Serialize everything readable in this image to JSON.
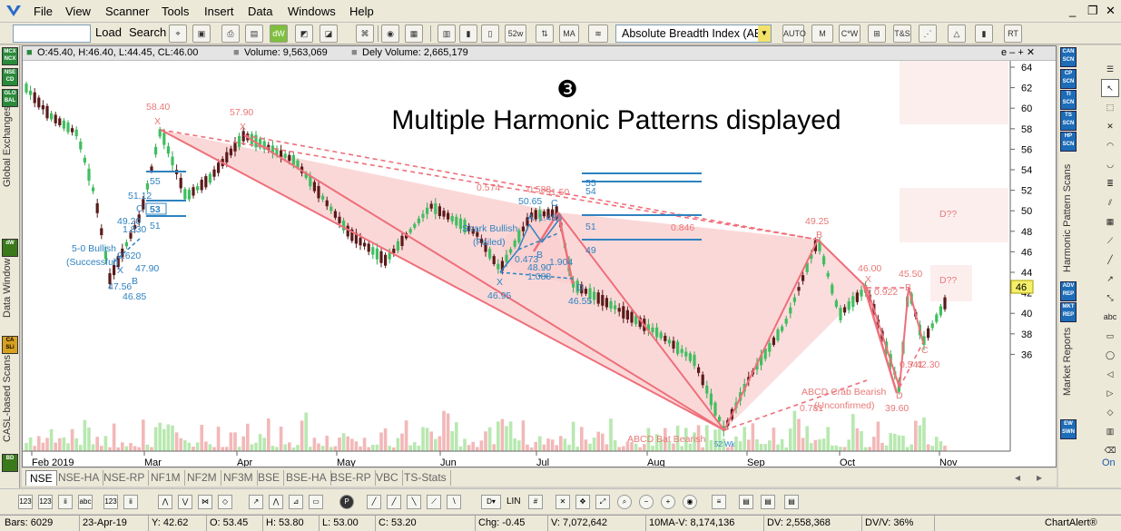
{
  "menu": {
    "items": [
      "File",
      "View",
      "Scanner",
      "Tools",
      "Insert",
      "Data",
      "Windows",
      "Help"
    ],
    "window_controls": [
      "_",
      "❐",
      "✕"
    ]
  },
  "toolbar": {
    "load": "Load",
    "search": "Search",
    "indicator": "Absolute Breadth Index (ABI",
    "btn_52w": "52w HiLo",
    "btn_ma": "MA",
    "btn_fibo": "AUTO FIBO",
    "btn_pvt": "M PVT",
    "btn_cw": "C*W TAM",
    "btn_ts": "T&S",
    "btn_rt": "RT"
  },
  "left_panel": {
    "btn1": "MCX NCX",
    "btn2": "NSE CD",
    "btn3": "GLO BAL",
    "label1": "Global Exchanges",
    "btn4": "dW",
    "label2": "Data Window",
    "btn5": "CA SLi",
    "label3": "CASL-based Scans",
    "btn6": "BD"
  },
  "infobar": {
    "ohlc": "O:45.40, H:46.40, L:44.45, CL:46.00",
    "volume": "Volume: 9,563,069",
    "dely": "Dely Volume: 2,665,179",
    "controls": "e – + ✕"
  },
  "chart": {
    "annotation_number": "❸",
    "annotation_text": "Multiple Harmonic Patterns displayed",
    "price_ticks": [
      "64",
      "62",
      "60",
      "58",
      "56",
      "54",
      "52",
      "50",
      "48",
      "46",
      "44",
      "42",
      "40",
      "38",
      "36"
    ],
    "current_price": "46",
    "months": [
      "Feb 2019",
      "Mar",
      "Apr",
      "May",
      "Jun",
      "Jul",
      "Aug",
      "Sep",
      "Oct",
      "Nov"
    ],
    "labels": {
      "x_price": "58.40",
      "x_mark": "X",
      "x2_price": "57.90",
      "x2_mark": "X",
      "v574": "0.574",
      "v588": "0.588",
      "v150": "51.50",
      "shark": "Shark Bullish",
      "shark_status": "(Failed)",
      "s5065": "50.65",
      "s1486": "1.486",
      "s0473": "0.473",
      "s1904": "1.904",
      "s4890": "48.90",
      "s1088": "1.088",
      "sa": "A",
      "sb": "B",
      "sc": "C",
      "sx": "X",
      "sd": "D",
      "s4695": "46.95",
      "s4655": "46.55",
      "r55": "55",
      "r54": "54",
      "r51": "51",
      "r49": "49",
      "r0846": "0.846",
      "b4925": "49.25",
      "bb": "B",
      "b4600": "46.00",
      "bx": "X",
      "b0922": "0.922",
      "b4550": "45.50",
      "b2": "B",
      "dq1": "D??",
      "dq2": "D??",
      "c0541": "0.541",
      "c4230": "42.30",
      "cc": "C",
      "cd": "D",
      "c3960": "39.60",
      "crab": "ABCD Crab Bearish",
      "crab_status": "(Unconfirmed)",
      "c0781": "0.781",
      "bat": "ABCD Bat Bearish",
      "w52": "52 Wk",
      "p50": "5-0 Bullish",
      "p50s": "(Successful)",
      "p5112": "51.12",
      "p4920": "49.20",
      "p1830": "1.830",
      "p0620": "0.620",
      "p4790": "47.90",
      "p4756": "47.56",
      "p4685": "46.85",
      "pc": "C",
      "pb": "B",
      "px": "X",
      "r55b": "55",
      "r53": "53",
      "r51b": "51",
      "r53v": "53"
    }
  },
  "tabs": [
    "NSE",
    "NSE-HA",
    "NSE-RP",
    "NF1M",
    "NF2M",
    "NF3M",
    "BSE",
    "BSE-HA",
    "BSE-RP",
    "VBC",
    "TS-Stats"
  ],
  "right_panel": {
    "b1": "CAN SCN",
    "b2": "CP SCN",
    "b3": "TI SCN",
    "b4": "TS SCN",
    "b5": "HP SCN",
    "label1": "Harmonic Pattern Scans",
    "b6": "ADV REP",
    "b7": "MKT REP",
    "label2": "Market Reports",
    "b8": "EW SWN",
    "on": "On",
    "abc": "abc"
  },
  "status": {
    "bars": "Bars: 6029",
    "date": "23-Apr-19",
    "y": "Y: 42.62",
    "o": "O: 53.45",
    "h": "H: 53.80",
    "l": "L: 53.00",
    "c": "C: 53.20",
    "chg": "Chg: -0.45",
    "v": "V: 7,072,642",
    "ma": "10MA-V: 8,174,136",
    "dv": "DV: 2,558,368",
    "dvv": "DV/V: 36%",
    "brand": "ChartAlert®"
  },
  "bottom": {
    "lin": "LIN"
  }
}
